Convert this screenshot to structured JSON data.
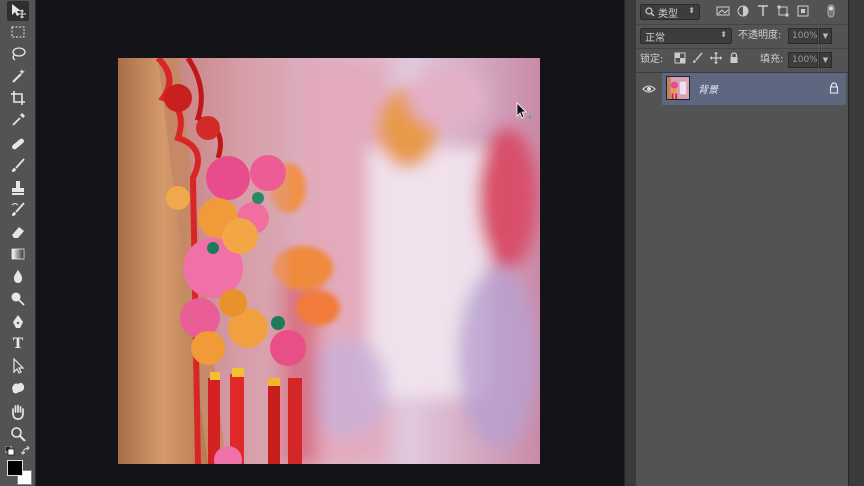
{
  "toolbox": {
    "tools": [
      {
        "name": "move-tool",
        "icon": "move-icon"
      },
      {
        "name": "marquee-tool",
        "icon": "rect-marquee-icon"
      },
      {
        "name": "lasso-tool",
        "icon": "lasso-icon"
      },
      {
        "name": "magic-wand-tool",
        "icon": "magic-wand-icon"
      },
      {
        "name": "crop-tool",
        "icon": "crop-icon"
      },
      {
        "name": "eyedropper-tool",
        "icon": "eyedropper-icon"
      },
      {
        "name": "healing-brush-tool",
        "icon": "bandage-icon"
      },
      {
        "name": "brush-tool",
        "icon": "brush-icon"
      },
      {
        "name": "clone-stamp-tool",
        "icon": "stamp-icon"
      },
      {
        "name": "history-brush-tool",
        "icon": "history-brush-icon"
      },
      {
        "name": "eraser-tool",
        "icon": "eraser-icon"
      },
      {
        "name": "gradient-tool",
        "icon": "gradient-icon"
      },
      {
        "name": "blur-tool",
        "icon": "drop-icon"
      },
      {
        "name": "dodge-tool",
        "icon": "dodge-icon"
      },
      {
        "name": "pen-tool",
        "icon": "pen-icon"
      },
      {
        "name": "type-tool",
        "icon": "type-icon",
        "label": "T"
      },
      {
        "name": "path-selection-tool",
        "icon": "arrow-icon"
      },
      {
        "name": "shape-tool",
        "icon": "custom-shape-icon"
      },
      {
        "name": "hand-tool",
        "icon": "hand-icon"
      },
      {
        "name": "zoom-tool",
        "icon": "magnifier-icon"
      }
    ],
    "foreground_color": "#000000",
    "background_color": "#ffffff"
  },
  "layers_panel": {
    "filter": {
      "kind_label": "类型",
      "icon": "search-icon"
    },
    "filter_icons": [
      "image-filter-icon",
      "adjustment-filter-icon",
      "type-filter-icon",
      "shape-filter-icon",
      "smart-object-filter-icon",
      "filter-toggle-icon"
    ],
    "blend_mode": "正常",
    "opacity_label": "不透明度:",
    "opacity_value": "100%",
    "lock_label": "锁定:",
    "lock_icons": [
      "lock-transparent-icon",
      "lock-image-icon",
      "lock-position-icon",
      "lock-all-icon"
    ],
    "fill_label": "填充:",
    "fill_value": "100%",
    "layers": [
      {
        "name": "背景",
        "visible": true,
        "locked": true,
        "selected": true
      }
    ]
  },
  "colors": {
    "panel_bg": "#535353",
    "workspace_bg": "#141318",
    "selected_layer": "#5d6780"
  }
}
